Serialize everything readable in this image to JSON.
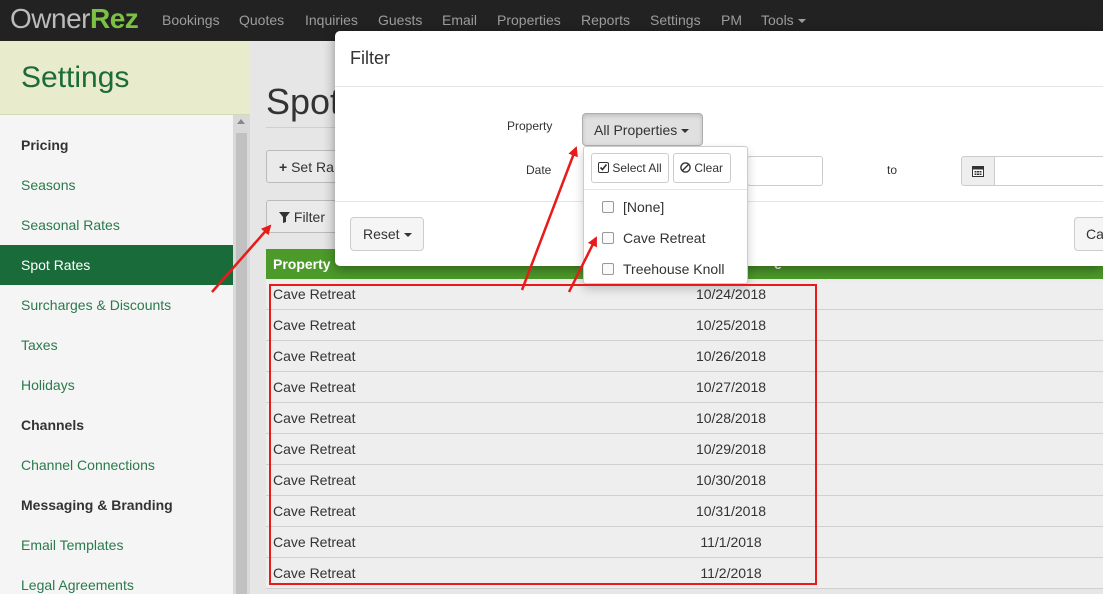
{
  "brand": {
    "part1": "Owner",
    "part2": "Rez"
  },
  "nav": [
    "Bookings",
    "Quotes",
    "Inquiries",
    "Guests",
    "Email",
    "Properties",
    "Reports",
    "Settings",
    "PM",
    "Tools"
  ],
  "sidebar": {
    "title": "Settings",
    "items": [
      {
        "label": "Pricing",
        "type": "section"
      },
      {
        "label": "Seasons",
        "type": "link"
      },
      {
        "label": "Seasonal Rates",
        "type": "link"
      },
      {
        "label": "Spot Rates",
        "type": "active"
      },
      {
        "label": "Surcharges & Discounts",
        "type": "link"
      },
      {
        "label": "Taxes",
        "type": "link"
      },
      {
        "label": "Holidays",
        "type": "link"
      },
      {
        "label": "Channels",
        "type": "section"
      },
      {
        "label": "Channel Connections",
        "type": "link"
      },
      {
        "label": "Messaging & Branding",
        "type": "section"
      },
      {
        "label": "Email Templates",
        "type": "link"
      },
      {
        "label": "Legal Agreements",
        "type": "link"
      }
    ]
  },
  "main": {
    "title": "Spot",
    "set_rates_label": "Set Ra",
    "filter_label": "Filter",
    "grid": {
      "header_property": "Property",
      "header_date": "e",
      "rows": [
        {
          "property": "Cave Retreat",
          "date": "10/24/2018"
        },
        {
          "property": "Cave Retreat",
          "date": "10/25/2018"
        },
        {
          "property": "Cave Retreat",
          "date": "10/26/2018"
        },
        {
          "property": "Cave Retreat",
          "date": "10/27/2018"
        },
        {
          "property": "Cave Retreat",
          "date": "10/28/2018"
        },
        {
          "property": "Cave Retreat",
          "date": "10/29/2018"
        },
        {
          "property": "Cave Retreat",
          "date": "10/30/2018"
        },
        {
          "property": "Cave Retreat",
          "date": "10/31/2018"
        },
        {
          "property": "Cave Retreat",
          "date": "11/1/2018"
        },
        {
          "property": "Cave Retreat",
          "date": "11/2/2018"
        }
      ]
    }
  },
  "modal": {
    "title": "Filter",
    "property_label": "Property",
    "property_value": "All Properties",
    "date_label": "Date",
    "to_label": "to",
    "reset_label": "Reset",
    "cancel_label": "Ca",
    "dropdown": {
      "select_all_label": "Select All",
      "clear_label": "Clear",
      "options": [
        "[None]",
        "Cave Retreat",
        "Treehouse Knoll"
      ]
    }
  },
  "colors": {
    "brand_green": "#7cc242",
    "sidebar_active": "#1a6b3a",
    "grid_header": "#4c9a2a",
    "annotation_red": "#e81a1a"
  }
}
